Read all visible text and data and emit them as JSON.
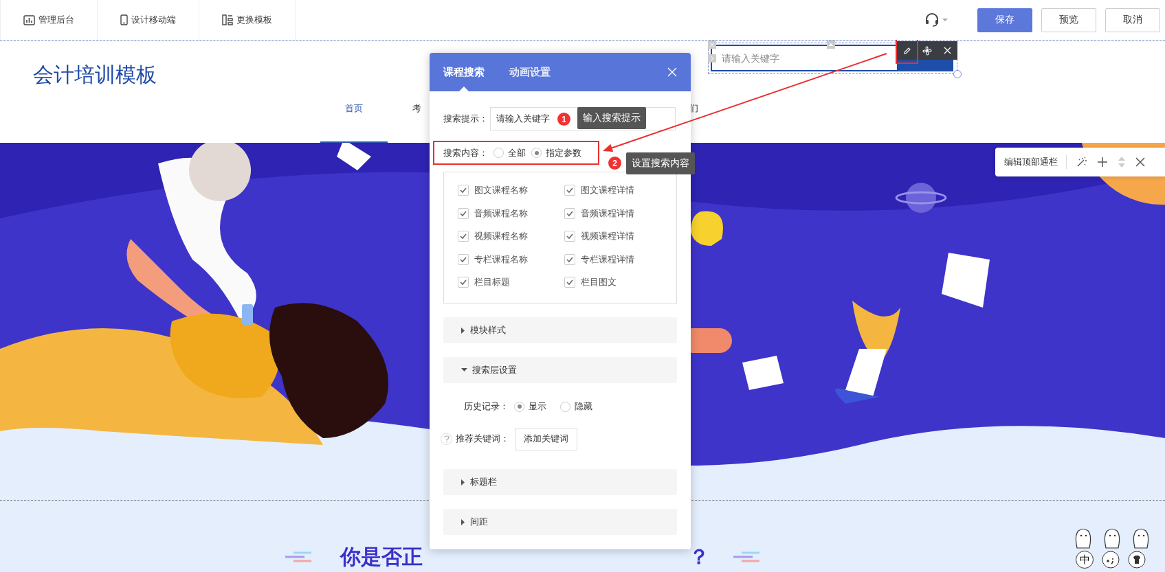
{
  "top_bar": {
    "tools": [
      {
        "label": "管理后台",
        "kind": "chart"
      },
      {
        "label": "设计移动端",
        "kind": "phone"
      },
      {
        "label": "更换模板",
        "kind": "layout"
      }
    ],
    "buttons": [
      {
        "label": "保存",
        "kind": "primary"
      },
      {
        "label": "预览",
        "kind": "default"
      },
      {
        "label": "取消",
        "kind": "default"
      }
    ]
  },
  "site_header": {
    "logo": "会计培训模板",
    "nav": [
      {
        "label": "首页",
        "selected": true
      },
      {
        "label": "考",
        "selected": false
      },
      {
        "label": "们",
        "selected": false
      }
    ]
  },
  "search_widget": {
    "placeholder": "请输入关键字"
  },
  "edit_bar": {
    "label": "编辑顶部通栏"
  },
  "settings_panel": {
    "tabs": [
      {
        "label": "课程搜索",
        "selected": true
      },
      {
        "label": "动画设置",
        "selected": false
      }
    ],
    "hint_label": "搜索提示：",
    "hint_field": {
      "value": "请输入关键字"
    },
    "steps": [
      {
        "number": "1",
        "text": "输入搜索提示"
      },
      {
        "number": "2",
        "text": "设置搜索内容"
      }
    ],
    "content_label": "搜索内容：",
    "content_options": [
      {
        "label": "全部",
        "selected": false
      },
      {
        "label": "指定参数",
        "selected": true
      }
    ],
    "content_items": [
      {
        "label": "图文课程名称",
        "checked": true
      },
      {
        "label": "图文课程详情",
        "checked": true
      },
      {
        "label": "音频课程名称",
        "checked": true
      },
      {
        "label": "音频课程详情",
        "checked": true
      },
      {
        "label": "视频课程名称",
        "checked": true
      },
      {
        "label": "视频课程详情",
        "checked": true
      },
      {
        "label": "专栏课程名称",
        "checked": true
      },
      {
        "label": "专栏课程详情",
        "checked": true
      },
      {
        "label": "栏目标题",
        "checked": true
      },
      {
        "label": "栏目图文",
        "checked": true
      }
    ],
    "sections": [
      {
        "title": "模块样式",
        "expanded": false
      },
      {
        "title": "搜索层设置",
        "expanded": true,
        "body": {
          "history_label": "历史记录：",
          "history_options": [
            {
              "label": "显示",
              "selected": true
            },
            {
              "label": "隐藏",
              "selected": false
            }
          ],
          "keywords_label": "推荐关键词：",
          "keywords_button": "添加关键词"
        }
      },
      {
        "title": "标题栏",
        "expanded": false
      },
      {
        "title": "间距",
        "expanded": false
      }
    ]
  },
  "bottom_heading": {
    "left": "你是否正",
    "right": "？"
  },
  "ime": {
    "mode": "中"
  }
}
